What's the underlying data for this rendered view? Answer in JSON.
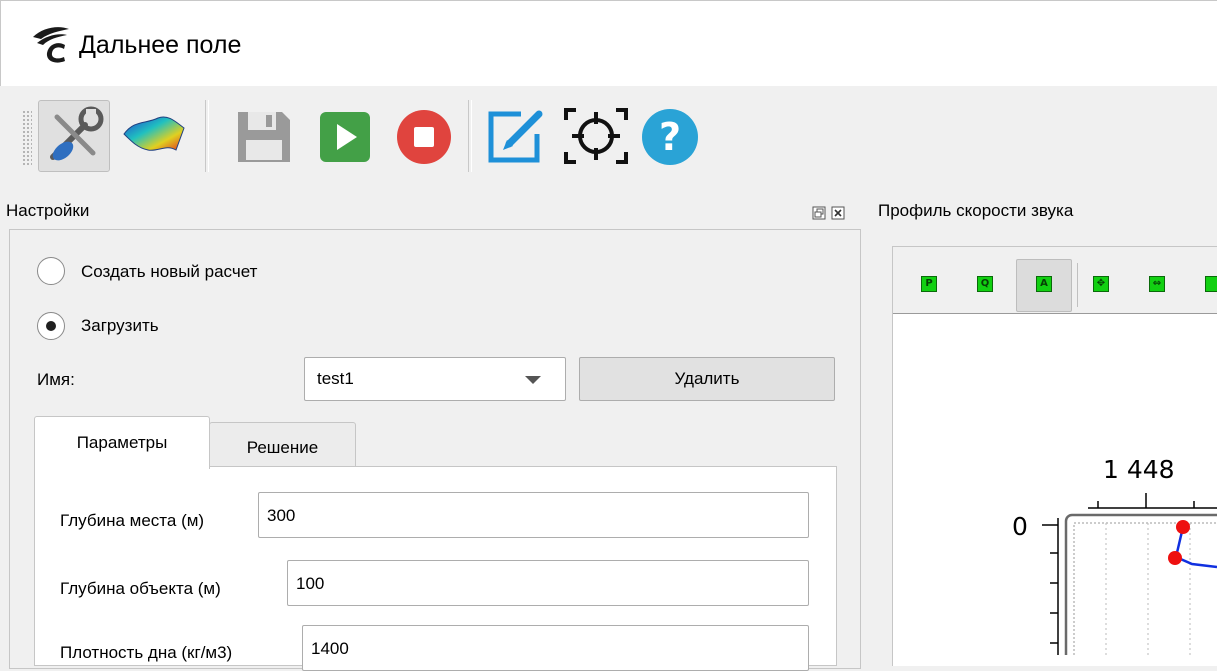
{
  "window": {
    "title": "Дальнее поле"
  },
  "toolbar": {
    "icons": [
      "settings-tools-icon",
      "surface-plot-icon",
      "save-icon",
      "run-icon",
      "stop-icon",
      "edit-icon",
      "target-icon",
      "help-icon"
    ]
  },
  "settings": {
    "title": "Настройки",
    "radio_new": "Создать новый расчет",
    "radio_new_checked": false,
    "radio_load": "Загрузить",
    "radio_load_checked": true,
    "name_label": "Имя:",
    "name_value": "test1",
    "delete_label": "Удалить",
    "tabs": {
      "params": "Параметры",
      "solution": "Решение"
    },
    "fields": {
      "depth_site_label": "Глубина места (м)",
      "depth_site_value": "300",
      "depth_object_label": "Глубина объекта (м)",
      "depth_object_value": "100",
      "bottom_density_label": "Плотность дна (кг/м3)",
      "bottom_density_value": "1400"
    }
  },
  "profile": {
    "title": "Профиль скорости звука",
    "plot_tools": [
      "P",
      "Q",
      "A",
      "pan",
      "zoom",
      "fit"
    ],
    "top_axis_tick": "1 448",
    "left_axis_tick": "0"
  },
  "colors": {
    "run_green": "#43a047",
    "stop_red": "#e0443e",
    "help_blue": "#2aa3d6",
    "edit_blue": "#1e90d8"
  }
}
